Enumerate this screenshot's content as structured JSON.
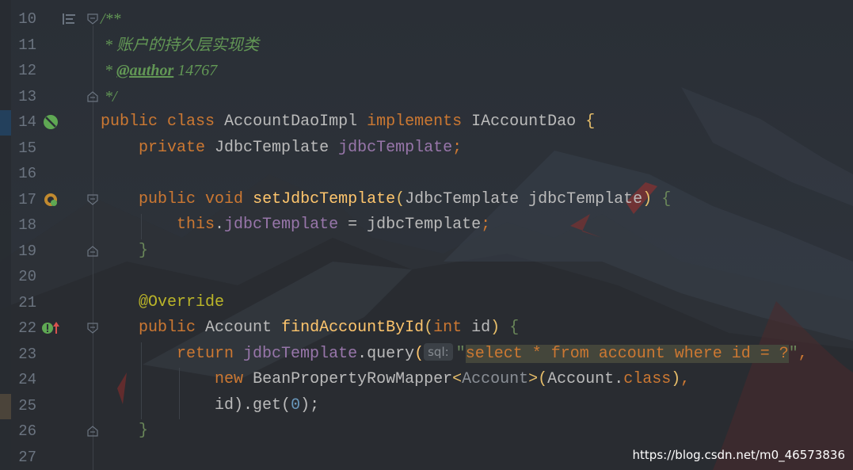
{
  "editor": {
    "lines": [
      {
        "num": "10",
        "text": "/**"
      },
      {
        "num": "11",
        "text": " * 账户的持久层实现类"
      },
      {
        "num": "12",
        "tag": "@author",
        "text": " 14767"
      },
      {
        "num": "13",
        "text": " */"
      },
      {
        "num": "14",
        "t1": "public",
        "t2": "class",
        "t3": "AccountDaoImpl",
        "t4": "implements",
        "t5": "IAccountDao",
        "t6": "{"
      },
      {
        "num": "15",
        "t1": "private",
        "t2": "JdbcTemplate",
        "t3": "jdbcTemplate",
        "t4": ";"
      },
      {
        "num": "16"
      },
      {
        "num": "17",
        "t1": "public",
        "t2": "void",
        "t3": "setJdbcTemplate",
        "t4": "(",
        "t5": "JdbcTemplate jdbcTemplate",
        "t6": ")",
        "t7": "{"
      },
      {
        "num": "18",
        "t1": "this",
        "t2": ".",
        "t3": "jdbcTemplate",
        "t4": " = jdbcTemplate",
        "t5": ";"
      },
      {
        "num": "19",
        "t1": "}"
      },
      {
        "num": "20"
      },
      {
        "num": "21",
        "t1": "@Override"
      },
      {
        "num": "22",
        "t1": "public",
        "t2": "Account",
        "t3": "findAccountById",
        "t4": "(",
        "t5": "int",
        "t6": " id",
        "t7": ")",
        "t8": "{"
      },
      {
        "num": "23",
        "t1": "return",
        "t2": "jdbcTemplate",
        "t3": ".query",
        "t4": "(",
        "hint": "sql:",
        "t5": "\"",
        "t6": "select * from account where id = ?",
        "t7": "\"",
        "t8": ","
      },
      {
        "num": "24",
        "t1": "new",
        "t2": "BeanPropertyRowMapper",
        "t3": "<",
        "t4": "Account",
        "t5": ">",
        "t6": "(",
        "t7": "Account",
        "t8": ".",
        "t9": "class",
        "t10": ")",
        "t11": ","
      },
      {
        "num": "25",
        "t1": "id",
        "t2": ").get(",
        "t3": "0",
        "t4": ");"
      },
      {
        "num": "26",
        "t1": "}"
      },
      {
        "num": "27"
      }
    ]
  },
  "gutter": {
    "icons": [
      "structure-icon",
      "bean-icon",
      "bean-override-icon",
      "implements-icon"
    ]
  },
  "colors": {
    "keyword": "#cc7832",
    "field": "#9876aa",
    "method": "#ffc66d",
    "comment": "#629755",
    "annotation": "#bbb529"
  },
  "watermark": "https://blog.csdn.net/m0_46573836"
}
